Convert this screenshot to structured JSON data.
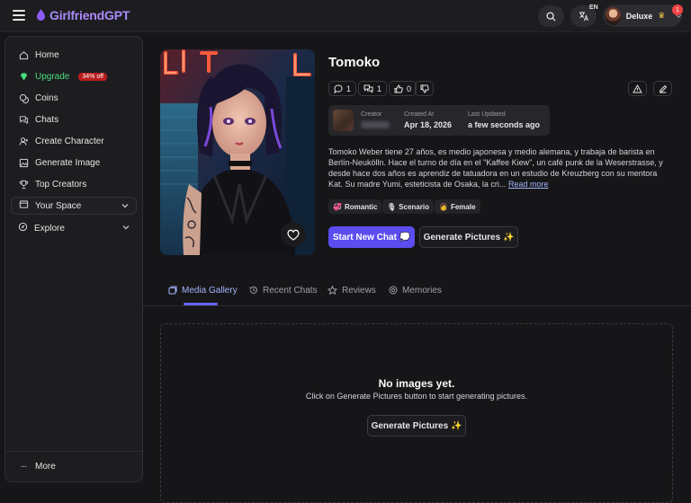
{
  "header": {
    "brand": "GirlfriendGPT",
    "language": "EN",
    "user_name": "Deluxe",
    "notification_count": "1"
  },
  "sidebar": {
    "items": [
      {
        "label": "Home",
        "icon": "home-icon"
      },
      {
        "label": "Upgrade",
        "icon": "gem-icon",
        "badge": "34% off"
      },
      {
        "label": "Coins",
        "icon": "coins-icon"
      },
      {
        "label": "Chats",
        "icon": "chat-icon"
      },
      {
        "label": "Create Character",
        "icon": "user-plus-icon"
      },
      {
        "label": "Generate Image",
        "icon": "image-icon"
      },
      {
        "label": "Top Creators",
        "icon": "trophy-icon"
      }
    ],
    "groups": [
      {
        "label": "Your Space",
        "icon": "folder-icon"
      },
      {
        "label": "Explore",
        "icon": "compass-icon"
      }
    ],
    "more_label": "More"
  },
  "profile": {
    "name": "Tomoko",
    "stats": {
      "messages": "1",
      "chats": "1",
      "likes": "0"
    },
    "meta": {
      "creator_label": "Creator",
      "created_label": "Created At",
      "created_value": "Apr 18, 2026",
      "updated_label": "Last Updated",
      "updated_value": "a few seconds ago"
    },
    "description": "Tomoko Weber tiene 27 años, es medio japonesa y medio alemana, y trabaja de barista en Berlín-Neukölln. Hace el turno de día en el \"Kaffee Kiew\", un café punk de la Weserstrasse, y desde hace dos años es aprendiz de tatuadora en un estudio de Kreuzberg con su mentora Kat. Su madre Yumi, esteticista de Osaka, la cri...",
    "read_more": "Read more",
    "tags": [
      {
        "emoji": "💞",
        "label": "Romantic"
      },
      {
        "emoji": "🎙",
        "label": "Scenario"
      },
      {
        "emoji": "👩",
        "label": "Female"
      }
    ],
    "start_chat_label": "Start New Chat 💭",
    "generate_label": "Generate Pictures ✨"
  },
  "tabs": [
    {
      "label": "Media Gallery",
      "icon": "gallery-icon",
      "active": true
    },
    {
      "label": "Recent Chats",
      "icon": "history-icon",
      "active": false
    },
    {
      "label": "Reviews",
      "icon": "star-icon",
      "active": false
    },
    {
      "label": "Memories",
      "icon": "memory-icon",
      "active": false
    }
  ],
  "gallery": {
    "empty_title": "No images yet.",
    "empty_sub": "Click on Generate Pictures button to start generating pictures.",
    "button_label": "Generate Pictures ✨"
  },
  "colors": {
    "accent": "#5b4df0",
    "upgrade": "#4ade80",
    "badge": "#b91c1c",
    "brand": "#a78bfa"
  }
}
